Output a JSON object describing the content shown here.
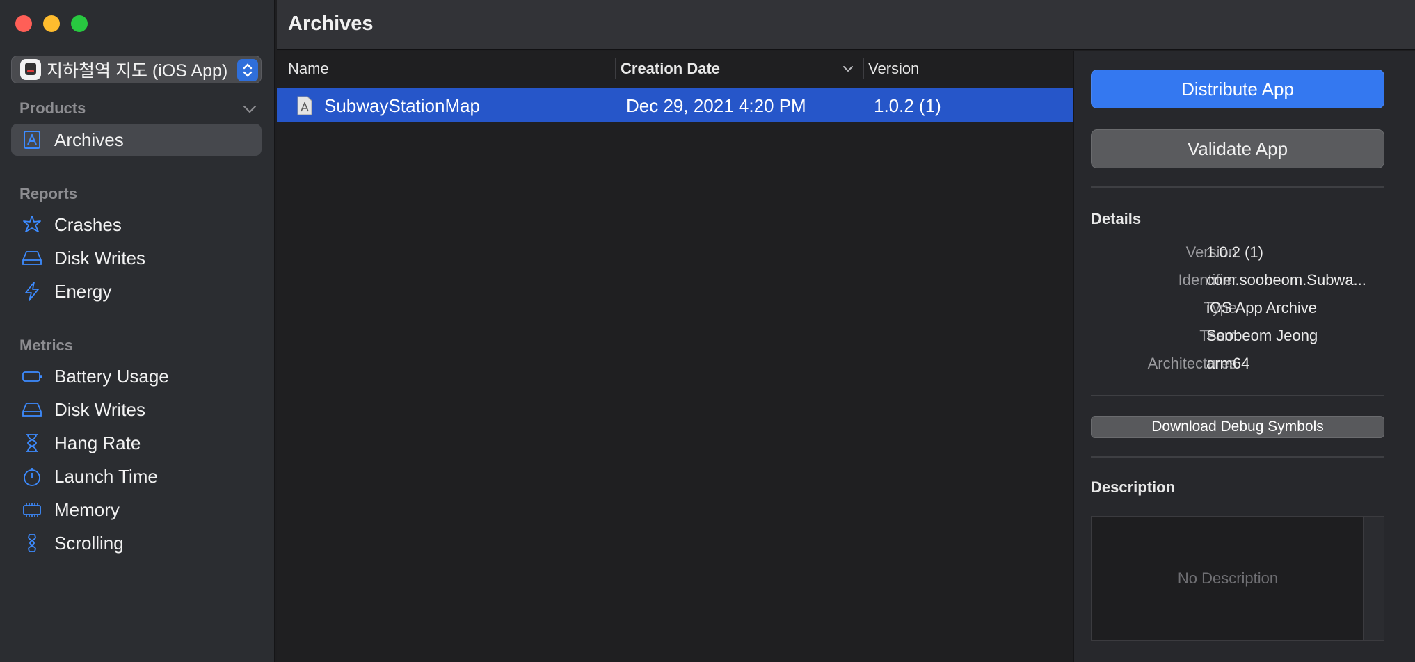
{
  "app_picker": {
    "name": "지하철역 지도 (iOS App)"
  },
  "sidebar": {
    "products_header": "Products",
    "products": [
      {
        "label": "Archives",
        "icon": "archives-icon",
        "selected": true
      }
    ],
    "reports_header": "Reports",
    "reports": [
      {
        "label": "Crashes",
        "icon": "crashes-icon"
      },
      {
        "label": "Disk Writes",
        "icon": "disk-icon"
      },
      {
        "label": "Energy",
        "icon": "energy-icon"
      }
    ],
    "metrics_header": "Metrics",
    "metrics": [
      {
        "label": "Battery Usage",
        "icon": "battery-icon"
      },
      {
        "label": "Disk Writes",
        "icon": "disk-icon"
      },
      {
        "label": "Hang Rate",
        "icon": "hourglass-icon"
      },
      {
        "label": "Launch Time",
        "icon": "stopwatch-icon"
      },
      {
        "label": "Memory",
        "icon": "memory-chip-icon"
      },
      {
        "label": "Scrolling",
        "icon": "scrolling-icon"
      }
    ]
  },
  "header": {
    "title": "Archives"
  },
  "table": {
    "columns": [
      "Name",
      "Creation Date",
      "Version"
    ],
    "rows": [
      {
        "name": "SubwayStationMap",
        "date": "Dec 29, 2021 4:20 PM",
        "version": "1.0.2 (1)",
        "selected": true
      }
    ]
  },
  "panel": {
    "distribute_label": "Distribute App",
    "validate_label": "Validate App",
    "details_header": "Details",
    "details": [
      {
        "key": "Version",
        "value": "1.0.2 (1)"
      },
      {
        "key": "Identifier",
        "value": "com.soobeom.Subwa..."
      },
      {
        "key": "Type",
        "value": "iOS App Archive"
      },
      {
        "key": "Team",
        "value": "Soobeom Jeong"
      },
      {
        "key": "Architectures",
        "value": "arm64"
      }
    ],
    "download_symbols_label": "Download Debug Symbols",
    "description_header": "Description",
    "description_placeholder": "No Description"
  },
  "colors": {
    "accent": "#3478f0",
    "selection": "#2656c9",
    "icon_blue": "#3d8bff"
  }
}
